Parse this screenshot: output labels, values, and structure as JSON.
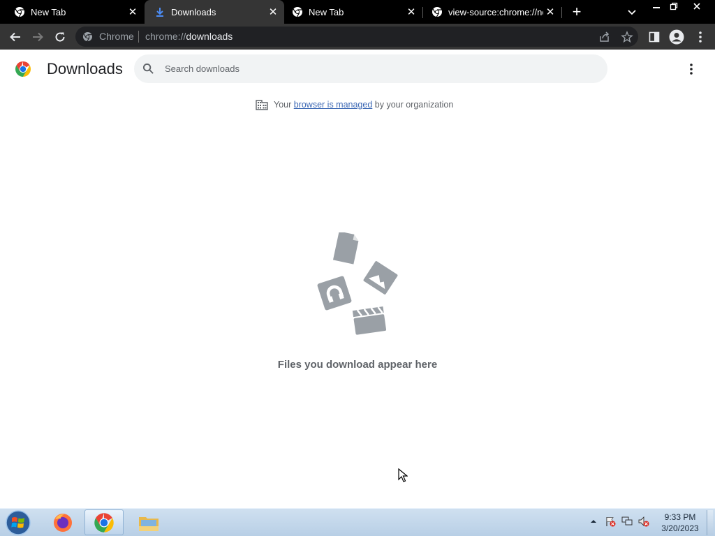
{
  "browser": {
    "tabs": [
      {
        "label": "New Tab",
        "icon": "chrome-icon",
        "active": false
      },
      {
        "label": "Downloads",
        "icon": "download-icon",
        "active": true
      },
      {
        "label": "New Tab",
        "icon": "chrome-icon",
        "active": false
      },
      {
        "label": "view-source:chrome://ne",
        "icon": "chrome-icon",
        "active": false
      }
    ],
    "close_glyph": "✕",
    "new_tab_glyph": "+",
    "omnibox": {
      "chip": "Chrome",
      "scheme": "chrome://",
      "host": "downloads"
    }
  },
  "page": {
    "title": "Downloads",
    "search_placeholder": "Search downloads",
    "managed": {
      "prefix": "Your ",
      "link": "browser is managed",
      "suffix": " by your organization"
    },
    "empty_message": "Files you download appear here"
  },
  "taskbar": {
    "apps": [
      "firefox-icon",
      "chrome-icon",
      "file-explorer-icon"
    ],
    "clock_time": "9:33 PM",
    "clock_date": "3/20/2023"
  },
  "colors": {
    "tabstrip_bg": "#000000",
    "toolbar_bg": "#353535",
    "illustration_gray": "#9aa0a6",
    "link": "#3c68b4"
  }
}
